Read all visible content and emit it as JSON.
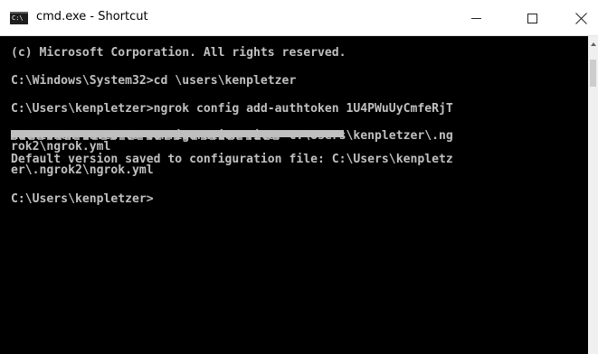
{
  "window": {
    "title": "cmd.exe - Shortcut",
    "icon_label": "C:\\",
    "controls": {
      "minimize": "minimize",
      "maximize": "maximize",
      "close": "close"
    }
  },
  "console": {
    "lines": [
      "(c) Microsoft Corporation. All rights reserved.",
      "",
      "C:\\Windows\\System32>cd \\users\\kenpletzer",
      "",
      "C:\\Users\\kenpletzer>ngrok config add-authtoken 1U4PWuUyCmfeRjT",
      "Authtoken saved to configuration file: C:\\Users\\kenpletzer\\.ng",
      "rok2\\ngrok.yml",
      "Default version saved to configuration file: C:\\Users\\kenpletz",
      "er\\.ngrok2\\ngrok.yml",
      "",
      "C:\\Users\\kenpletzer>"
    ],
    "text_color": "#c0c0c0",
    "background": "#000000"
  }
}
